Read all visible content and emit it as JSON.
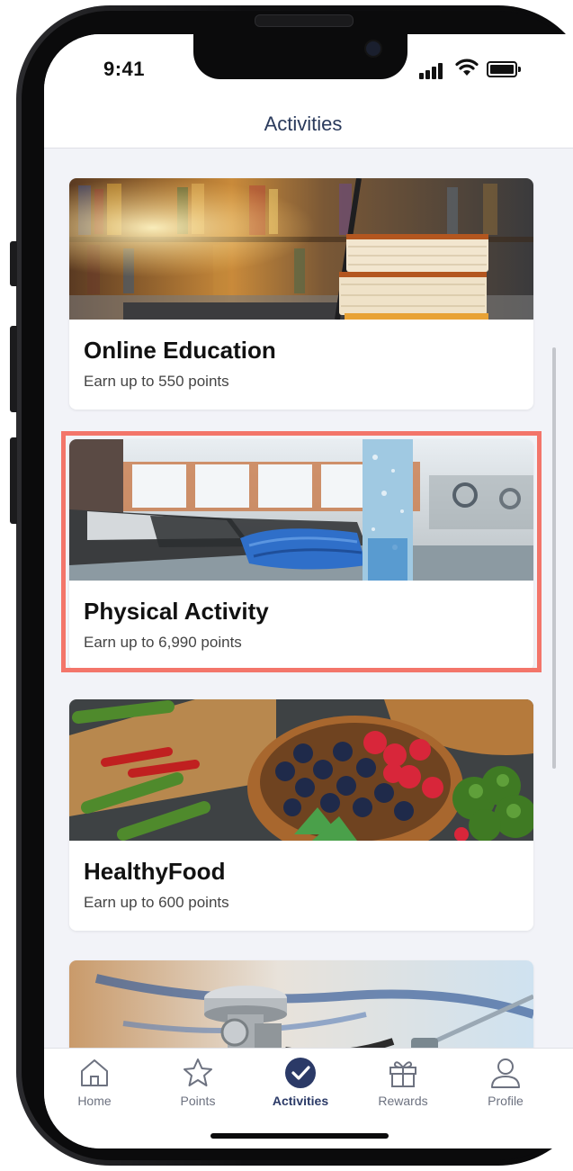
{
  "status_bar": {
    "time": "9:41"
  },
  "header": {
    "title": "Activities"
  },
  "activities": [
    {
      "title": "Online Education",
      "subtitle": "Earn up to 550 points"
    },
    {
      "title": "Physical Activity",
      "subtitle": "Earn up to 6,990 points"
    },
    {
      "title": "HealthyFood",
      "subtitle": "Earn up to 600 points"
    }
  ],
  "tabs": [
    {
      "label": "Home",
      "icon": "home-icon"
    },
    {
      "label": "Points",
      "icon": "star-icon"
    },
    {
      "label": "Activities",
      "icon": "check-circle-icon",
      "active": true
    },
    {
      "label": "Rewards",
      "icon": "gift-icon"
    },
    {
      "label": "Profile",
      "icon": "person-icon"
    }
  ],
  "colors": {
    "accent": "#2b3a67",
    "highlight": "#f3756a",
    "background": "#f2f3f8"
  }
}
